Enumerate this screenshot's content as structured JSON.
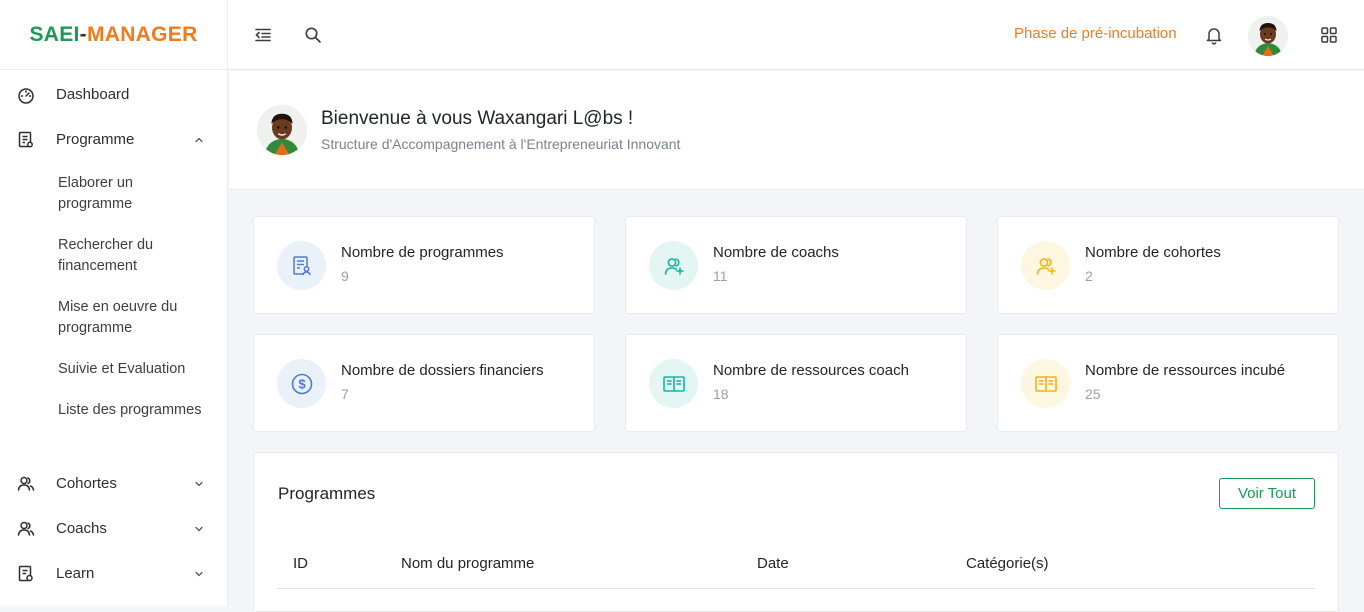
{
  "header": {
    "logo_part1": "SAEI",
    "logo_dash": "-",
    "logo_part2": "MANAGER",
    "phase": "Phase de pré-incubation",
    "icons": [
      "menu-collapse-icon",
      "search-icon",
      "bell-icon",
      "avatar",
      "apps-grid-icon"
    ]
  },
  "sidebar": {
    "items": [
      {
        "label": "Dashboard",
        "icon": "dashboard-gauge-icon"
      },
      {
        "label": "Programme",
        "icon": "document-icon"
      },
      {
        "label": "Cohortes",
        "icon": "users-icon"
      },
      {
        "label": "Coachs",
        "icon": "users-icon"
      },
      {
        "label": "Learn",
        "icon": "book-icon"
      }
    ],
    "sub_items": [
      {
        "label": "Elaborer un programme"
      },
      {
        "label": "Rechercher du financement"
      },
      {
        "label": "Mise en oeuvre du programme"
      },
      {
        "label": "Suivie et Evaluation"
      },
      {
        "label": "Liste des programmes"
      }
    ]
  },
  "welcome": {
    "title": "Bienvenue à vous Waxangari L@bs !",
    "subtitle": "Structure d'Accompagnement à l'Entrepreneuriat Innovant"
  },
  "cards": [
    {
      "label": "Nombre de programmes",
      "value": "9",
      "icon": "document-user-icon",
      "color": "#4a7bd8",
      "bg": "#eaf1fb"
    },
    {
      "label": "Nombre de coachs",
      "value": "11",
      "icon": "user-add-icon",
      "color": "#16b5a0",
      "bg": "#e4f6f3"
    },
    {
      "label": "Nombre de cohortes",
      "value": "2",
      "icon": "user-add-icon",
      "color": "#f5b316",
      "bg": "#fdf6e0"
    },
    {
      "label": "Nombre de dossiers financiers",
      "value": "7",
      "icon": "dollar-circle-icon",
      "color": "#4a7bd8",
      "bg": "#eaf1fb"
    },
    {
      "label": "Nombre de ressources coach",
      "value": "18",
      "icon": "open-book-icon",
      "color": "#16b5a0",
      "bg": "#e4f6f3"
    },
    {
      "label": "Nombre de ressources incubé",
      "value": "25",
      "icon": "open-book-icon",
      "color": "#f5b316",
      "bg": "#fdf6e0"
    }
  ],
  "programmes": {
    "title": "Programmes",
    "voir_tout": "Voir Tout",
    "columns": [
      "ID",
      "Nom du programme",
      "Date",
      "Catégorie(s)"
    ]
  },
  "colors": {
    "brand_green": "#1a9a52",
    "brand_orange": "#f07a1c",
    "phase_orange": "#ef7b22"
  }
}
